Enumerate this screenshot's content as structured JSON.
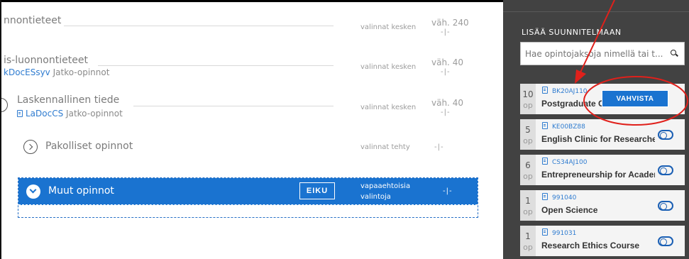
{
  "rows": [
    {
      "title": "nnontieteet",
      "status": "valinnat kesken",
      "credits": "väh. 240",
      "dash": "-|-"
    },
    {
      "title": "is-luonnontieteet",
      "code": "kDocESsyv",
      "sub": "Jatko-opinnot",
      "status": "valinnat kesken",
      "credits": "väh. 40",
      "dash": "-|-"
    },
    {
      "title": "Laskennallinen tiede",
      "code": "LaDocCS",
      "sub": "Jatko-opinnot",
      "status": "valinnat kesken",
      "credits": "väh. 40",
      "dash": "-|-"
    },
    {
      "title": "Pakolliset opinnot",
      "status": "valinnat tehty",
      "dash": "-|-"
    }
  ],
  "highlighted": {
    "title": "Muut opinnot",
    "button": "EIKU",
    "status_line1": "vapaaehtoisia",
    "status_line2": "valintoja",
    "dash": "-|-"
  },
  "sidebar": {
    "heading": "LISÄÄ SUUNNITELMAAN",
    "search_placeholder": "Hae opintojaksoja nimellä tai t...",
    "confirm_button": "VAHVISTA",
    "unit": "op",
    "courses": [
      {
        "credits": "10",
        "code": "BK20AJ110",
        "name": "Postgraduate Course"
      },
      {
        "credits": "5",
        "code": "KE00BZ88",
        "name": "English Clinic for Researchers"
      },
      {
        "credits": "6",
        "code": "CS34AJ100",
        "name": "Entrepreneurship for Academics"
      },
      {
        "credits": "1",
        "code": "991040",
        "name": "Open Science"
      },
      {
        "credits": "1",
        "code": "991031",
        "name": "Research Ethics Course"
      }
    ]
  },
  "colors": {
    "accent": "#1a73d0",
    "sidebar_bg": "#424242",
    "annotation": "#e0201b"
  }
}
